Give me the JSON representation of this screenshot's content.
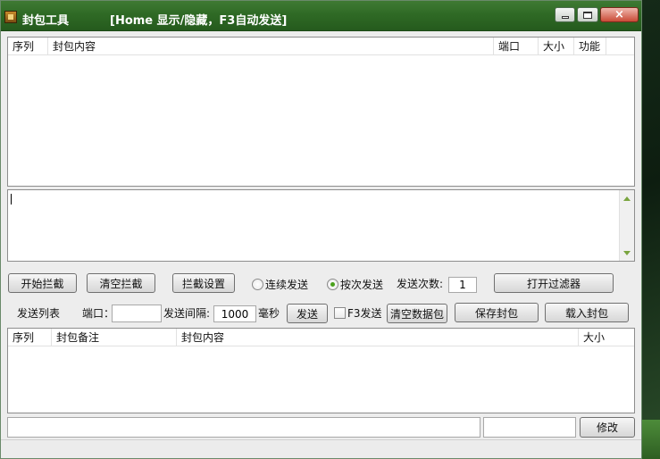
{
  "window": {
    "title": "封包工具",
    "hint": "[Home 显示/隐藏，F3自动发送]",
    "controls": {
      "minimize": "minimize",
      "maximize": "maximize",
      "close": "×"
    }
  },
  "capture_list": {
    "columns": [
      "序列",
      "封包内容",
      "端口",
      "大小",
      "功能"
    ],
    "rows": []
  },
  "editor": {
    "value": ""
  },
  "controls_row1": {
    "start_capture": "开始拦截",
    "clear_capture": "清空拦截",
    "capture_settings": "拦截设置",
    "continuous_send": "连续发送",
    "send_by_count": "按次发送",
    "send_count_label": "发送次数:",
    "send_count_value": "1",
    "open_filter": "打开过滤器"
  },
  "controls_row2": {
    "send_list_label": "发送列表",
    "port_label": "端口：",
    "port_value": "",
    "interval_label": "发送间隔:",
    "interval_value": "1000",
    "unit_label": "毫秒",
    "send_button": "发送",
    "f3_send": "F3发送",
    "clear_packets": "清空数据包",
    "save_packets": "保存封包",
    "load_packets": "载入封包"
  },
  "send_list": {
    "columns": [
      "序列",
      "封包备注",
      "封包内容",
      "大小"
    ],
    "rows": []
  },
  "bottom_bar": {
    "note_value": "",
    "size_value": "",
    "modify_button": "修改"
  }
}
